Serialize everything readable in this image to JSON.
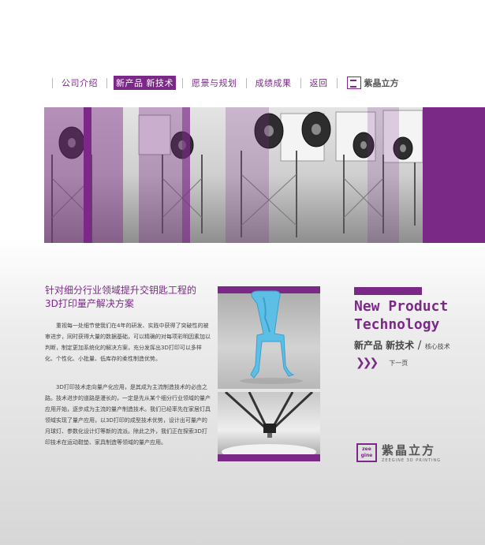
{
  "nav": {
    "items": [
      {
        "label": "公司介绍",
        "active": false
      },
      {
        "label": "新产品 新技术",
        "active": true
      },
      {
        "label": "愿景与规划",
        "active": false
      },
      {
        "label": "成绩成果",
        "active": false
      },
      {
        "label": "返回",
        "active": false
      }
    ],
    "logo_text": "紫晶立方"
  },
  "left": {
    "headline_line1": "针对细分行业领域提升交钥匙工程的",
    "headline_line2": "3D打印量产解决方案",
    "paragraph1": "重视每一处细节使我们在4年的研发、实践中获得了突破性的被审进步，同时获得大量的数据基础，可以精确的对每项彩明因素加以判断，制定更加系统化的解决方案，充分发挥出3D打印可以多样化、个性化、小批量、低库存的柔性制造优势。",
    "paragraph2": "3D打印技术走向量产化应用，是其成为主流制造技术的必由之路。技术进步的道路是漫长的，一定是先从某个细分行业领域的量产应用开始，逐步成为主流的量产制造技术。我们已经率先在家居灯具领域实现了量产应用，以3D打印的成型技术优势，设计出可量产的月球灯、参数化设计灯等新的流派。除此之外，我们正在探索3D打印技术在运动鞋垫、家具制造等领域的量产应用。"
  },
  "right": {
    "title_line1": "New Product",
    "title_line2": "Technology",
    "subtitle": "新产品 新技术",
    "subtitle_small": "核心技术",
    "next_label": "下一页"
  },
  "brand": {
    "mark_top": "zee",
    "mark_bottom": "gine",
    "name_cn": "紫晶立方",
    "name_en": "ZEEGINE 3D PRINTING"
  },
  "colors": {
    "accent": "#7a2a86",
    "text": "#444444"
  }
}
